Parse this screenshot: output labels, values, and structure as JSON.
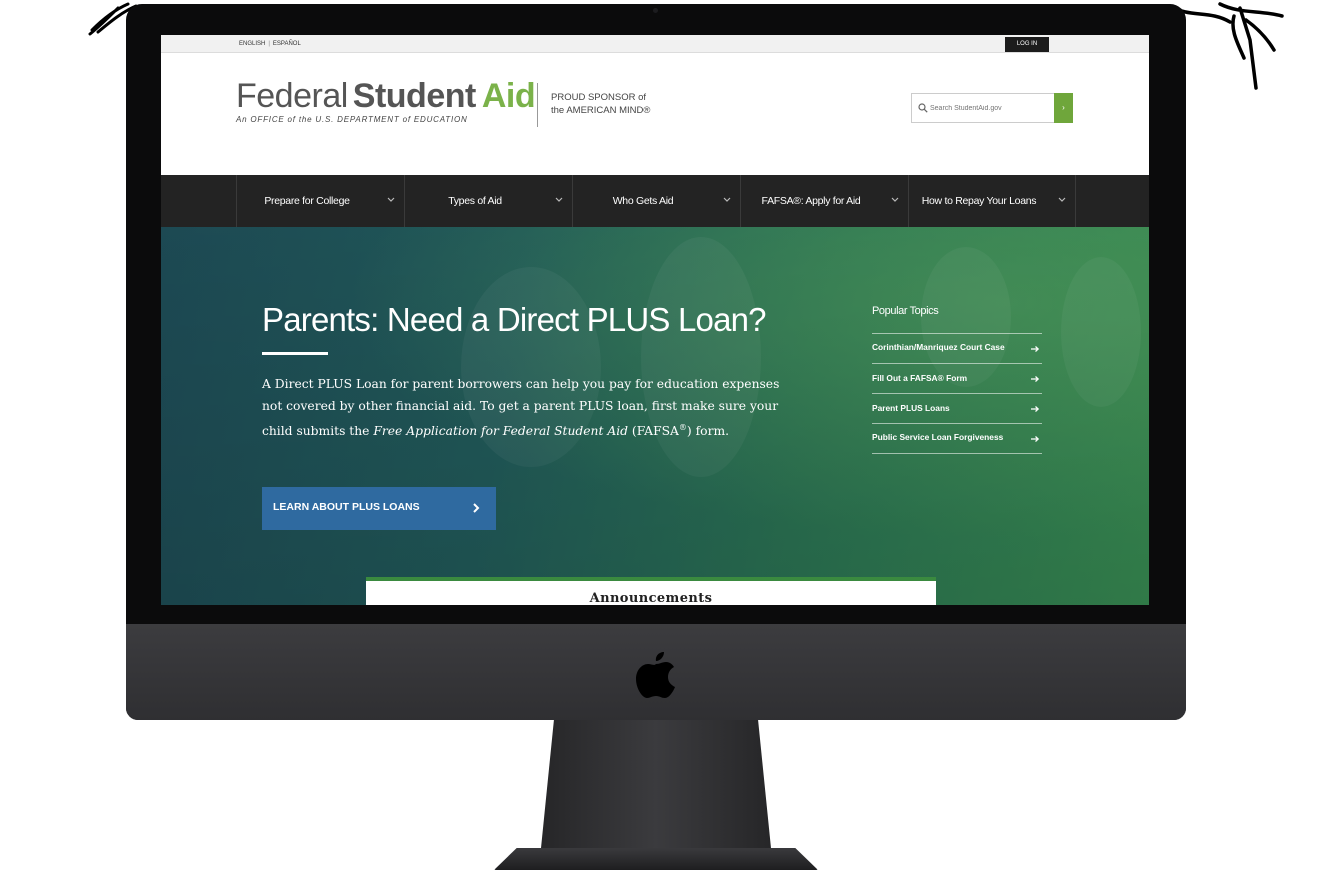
{
  "utility": {
    "lang_en": "ENGLISH",
    "lang_es": "ESPAÑOL",
    "login": "LOG IN"
  },
  "header": {
    "logo_word1": "Federal",
    "logo_word2": "Student",
    "logo_word3": "Aid",
    "logo_subtitle": "An OFFICE of the U.S. DEPARTMENT of EDUCATION",
    "sponsor_line1": "PROUD SPONSOR of",
    "sponsor_line2": "the AMERICAN MIND®",
    "search_placeholder": "Search StudentAid.gov",
    "search_go": "›"
  },
  "nav": {
    "items": [
      {
        "label": "Prepare for College"
      },
      {
        "label": "Types of Aid"
      },
      {
        "label": "Who Gets Aid"
      },
      {
        "label": "FAFSA®: Apply for Aid"
      },
      {
        "label": "How to Repay Your Loans"
      }
    ]
  },
  "hero": {
    "title": "Parents: Need a Direct PLUS Loan?",
    "body_part1": "A Direct PLUS Loan for parent borrowers can help you pay for education expenses not covered by other financial aid. To get a parent PLUS loan, first make sure your child submits the ",
    "body_italic": "Free Application for Federal Student Aid",
    "body_part2": " (FAFSA",
    "body_reg": "®",
    "body_part3": ") form.",
    "cta_label": "LEARN ABOUT PLUS LOANS"
  },
  "popular_topics": {
    "title": "Popular Topics",
    "items": [
      {
        "label": "Corinthian/Manriquez Court Case"
      },
      {
        "label": "Fill Out a FAFSA® Form"
      },
      {
        "label": "Parent PLUS Loans"
      },
      {
        "label": "Public Service Loan Forgiveness"
      }
    ]
  },
  "announcements": {
    "title": "Announcements"
  },
  "colors": {
    "brand_green": "#7bb24a",
    "nav_bg": "#232323",
    "cta_blue": "#2f6aa0"
  },
  "icons": {
    "search": "search-icon",
    "chevron": "chevron-down-icon",
    "arrow": "arrow-right-icon",
    "apple": "apple-logo-icon"
  }
}
